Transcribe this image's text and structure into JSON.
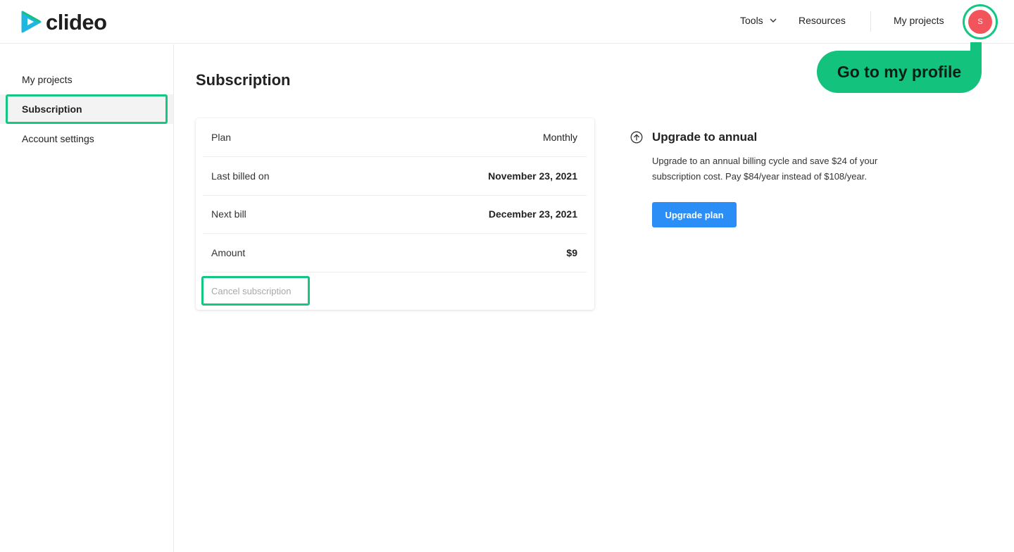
{
  "brand": {
    "name": "clideo",
    "accent_color": "#16c784",
    "logo_icon": "play-triangle-icon"
  },
  "header": {
    "nav": {
      "tools": "Tools",
      "resources": "Resources",
      "my_projects": "My projects"
    },
    "avatar_initial": "S",
    "avatar_color": "#f2545b"
  },
  "tooltip": {
    "text": "Go to my profile"
  },
  "sidebar": {
    "items": [
      {
        "label": "My projects",
        "active": false
      },
      {
        "label": "Subscription",
        "active": true
      },
      {
        "label": "Account settings",
        "active": false
      }
    ]
  },
  "main": {
    "title": "Subscription",
    "details": [
      {
        "label": "Plan",
        "value": "Monthly"
      },
      {
        "label": "Last billed on",
        "value": "November 23, 2021"
      },
      {
        "label": "Next bill",
        "value": "December 23, 2021"
      },
      {
        "label": "Amount",
        "value": "$9"
      }
    ],
    "cancel_label": "Cancel subscription"
  },
  "upgrade": {
    "icon": "arrow-up-circle-icon",
    "title": "Upgrade to annual",
    "description": "Upgrade to an annual billing cycle and save $24 of your subscription cost. Pay $84/year instead of $108/year.",
    "button_label": "Upgrade plan",
    "button_color": "#2b8ef7"
  }
}
